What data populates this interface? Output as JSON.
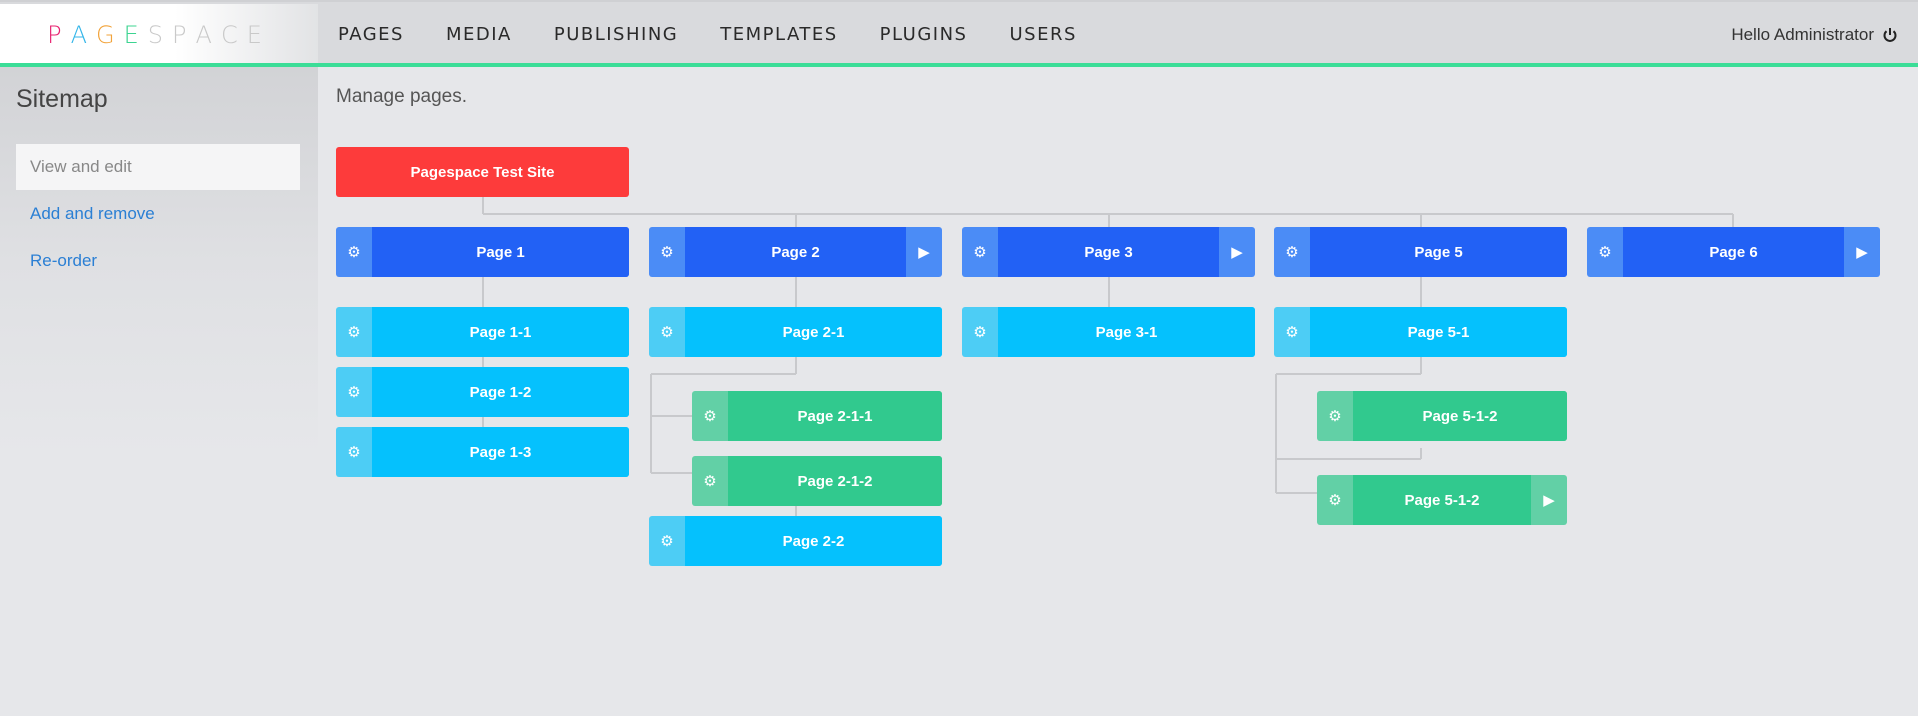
{
  "brand": {
    "letters": [
      "P",
      "A",
      "G",
      "E",
      "S",
      "P",
      "A",
      "C",
      "E"
    ],
    "colors": [
      "#e8216f",
      "#35b6e9",
      "#f2a33a",
      "#3cd491",
      "#c9c9c9",
      "#c9c9c9",
      "#c9c9c9",
      "#c9c9c9",
      "#c9c9c9"
    ]
  },
  "nav": {
    "items": [
      "PAGES",
      "MEDIA",
      "PUBLISHING",
      "TEMPLATES",
      "PLUGINS",
      "USERS"
    ],
    "user_greeting": "Hello Administrator"
  },
  "sidebar": {
    "title": "Sitemap",
    "items": [
      {
        "label": "View and edit",
        "active": true
      },
      {
        "label": "Add and remove",
        "active": false
      },
      {
        "label": "Re-order",
        "active": false
      }
    ]
  },
  "main": {
    "title": "Manage pages.",
    "root": "Pagespace Test Site",
    "pages": {
      "p1": "Page 1",
      "p2": "Page 2",
      "p3": "Page 3",
      "p5": "Page 5",
      "p6": "Page 6",
      "p11": "Page 1-1",
      "p12": "Page 1-2",
      "p13": "Page 1-3",
      "p21": "Page 2-1",
      "p211": "Page 2-1-1",
      "p212": "Page 2-1-2",
      "p22": "Page 2-2",
      "p31": "Page 3-1",
      "p51": "Page 5-1",
      "p512a": "Page 5-1-2",
      "p512b": "Page 5-1-2"
    }
  },
  "colors": {
    "accent_line": "#3bdd97",
    "root": "#fd3b3b",
    "level0": "#2261f5",
    "level1": "#05c1fd",
    "level2": "#31c98e",
    "link": "#2a7fd4"
  }
}
